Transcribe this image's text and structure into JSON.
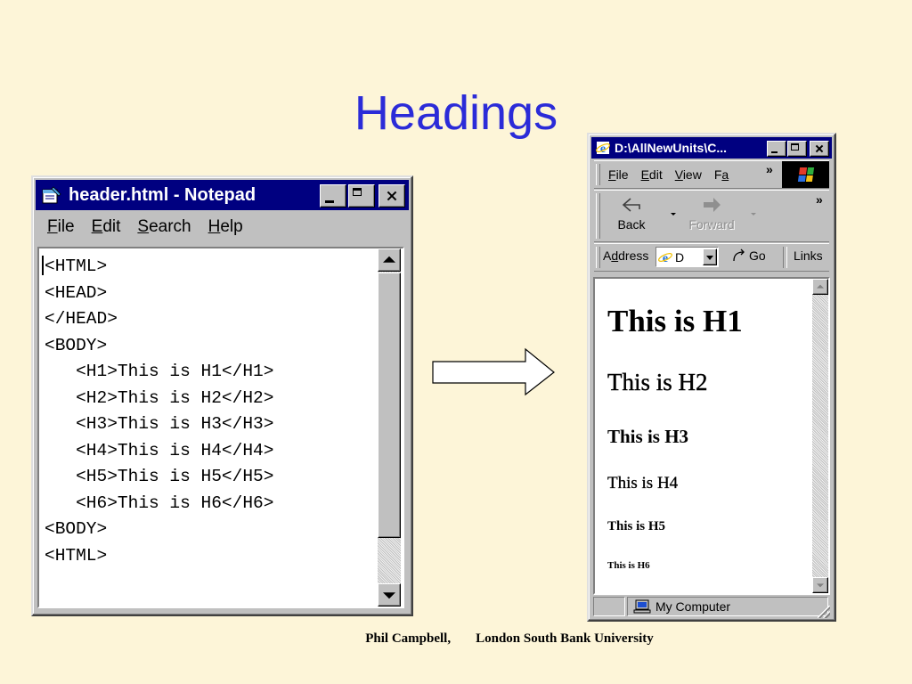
{
  "slide": {
    "title": "Headings",
    "footer_author": "Phil Campbell,",
    "footer_institution": "London South Bank University"
  },
  "notepad": {
    "title": "header.html - Notepad",
    "menu": [
      {
        "key": "F",
        "rest": "ile"
      },
      {
        "key": "E",
        "rest": "dit"
      },
      {
        "key": "S",
        "rest": "earch"
      },
      {
        "key": "H",
        "rest": "elp"
      }
    ],
    "lines": [
      "<HTML>",
      "<HEAD>",
      "</HEAD>",
      "<BODY>",
      "   <H1>This is H1</H1>",
      "   <H2>This is H2</H2>",
      "   <H3>This is H3</H3>",
      "   <H4>This is H4</H4>",
      "   <H5>This is H5</H5>",
      "   <H6>This is H6</H6>",
      "<BODY>",
      "<HTML>"
    ]
  },
  "browser": {
    "title": "D:\\AllNewUnits\\C...",
    "menu": [
      {
        "key": "F",
        "rest": "ile"
      },
      {
        "key": "E",
        "rest": "dit"
      },
      {
        "key": "V",
        "rest": "iew"
      },
      {
        "pre": "F",
        "key": "a",
        "rest": ""
      }
    ],
    "menu_more": "»",
    "toolbar_more": "»",
    "back_label": "Back",
    "forward_label": "Forward",
    "address_label": {
      "pre": "A",
      "key": "d",
      "rest": "dress"
    },
    "address_value": "D",
    "go_label": "Go",
    "links_label": "Links",
    "headings": [
      "This is H1",
      "This is H2",
      "This is H3",
      "This is H4",
      "This is H5",
      "This is H6"
    ],
    "status_zone": "My Computer"
  },
  "colors": {
    "slide_background": "#fdf5d8",
    "title_text": "#2b2bd8",
    "window_face": "#c0c0c0",
    "active_titlebar": "#000080"
  }
}
